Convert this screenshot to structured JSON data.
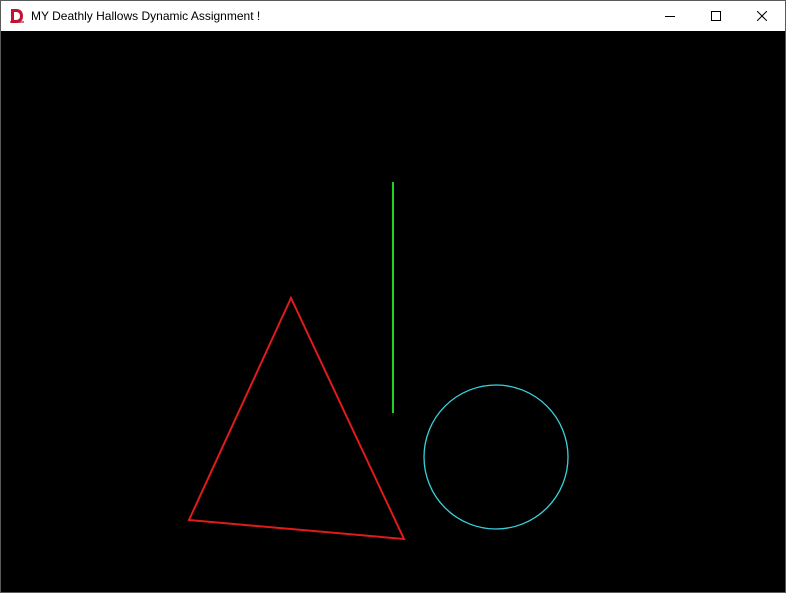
{
  "window": {
    "title": "MY Deathly Hallows Dynamic Assignment !",
    "app_icon": "d-logo-icon",
    "controls": [
      "minimize-icon",
      "maximize-icon",
      "close-icon"
    ]
  },
  "canvas": {
    "background": "#000000",
    "shapes": [
      {
        "name": "triangle",
        "color": "#e01b1b"
      },
      {
        "name": "line",
        "color": "#1fd21f"
      },
      {
        "name": "circle",
        "color": "#39d3df"
      }
    ]
  }
}
